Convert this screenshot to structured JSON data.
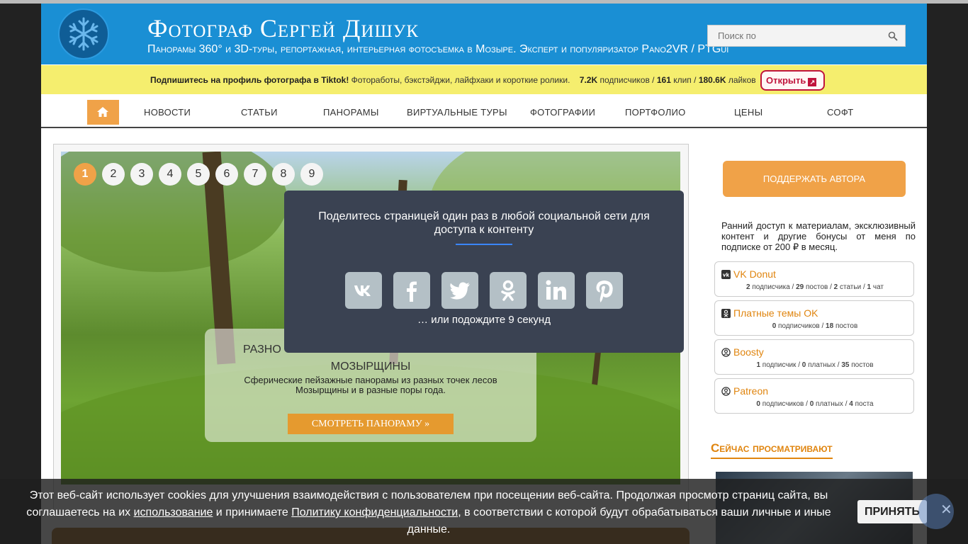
{
  "header": {
    "title": "Фотограф Сергей Дишук",
    "subtitle": "Панорамы 360° и 3D-туры, репортажная, интерьерная фотосъемка в Мозыре. Эксперт и популяризатор Pano2VR / PTGui",
    "search_placeholder": "Поиск по",
    "brand_color": "#1a8fd4"
  },
  "tiktok": {
    "lead": "Подпишитесь на профиль фотографа в Tiktok!",
    "text": " Фоторaботы, бэкстэйджи, лайфхаки и короткие ролики.",
    "subs_num": "7.2K",
    "subs_label": " подписчиков / ",
    "clips_num": "161",
    "clips_label": " клип / ",
    "likes_num": "180.6K",
    "likes_label": " лайков",
    "open_label": "Открыть"
  },
  "nav": {
    "items": [
      "НОВОСТИ",
      "СТАТЬИ",
      "ПАНОРАМЫ",
      "ВИРТУАЛЬНЫЕ ТУРЫ",
      "ФОТОГРАФИИ",
      "ПОРТФОЛИО",
      "ЦЕНЫ",
      "СОФТ"
    ]
  },
  "slider": {
    "pages": [
      "1",
      "2",
      "3",
      "4",
      "5",
      "6",
      "7",
      "8",
      "9"
    ],
    "active_page": "1",
    "caption_title_1": "РАЗНО",
    "caption_title_2": "МОЗЫРЩИНЫ",
    "caption_desc": "Сферические пейзажные панорамы из разных точек лесов Мозырщины и в разные поры года.",
    "caption_button": "СМОТРЕТЬ ПАНОРАМУ »"
  },
  "sidebar": {
    "support_button": "ПОДДЕРЖАТЬ АВТОРА",
    "support_text": "Ранний доступ к материалам, эксклюзивный контент и другие бонусы от меня по подписке от 200 ₽ в месяц.",
    "platforms": [
      {
        "name": "VK Donut",
        "icon": "vk-icon",
        "stats": [
          [
            "2",
            " подписчика / "
          ],
          [
            "29",
            " постов / "
          ],
          [
            "2",
            " статьи / "
          ],
          [
            "1",
            " чат"
          ]
        ]
      },
      {
        "name": "Платные темы OK",
        "icon": "ok-icon",
        "stats": [
          [
            "0",
            " подписчиков / "
          ],
          [
            "18",
            " постов"
          ]
        ]
      },
      {
        "name": "Boosty",
        "icon": "user-circle-icon",
        "stats": [
          [
            "1",
            " подписчик / "
          ],
          [
            "0",
            " платных / "
          ],
          [
            "35",
            " постов"
          ]
        ]
      },
      {
        "name": "Patreon",
        "icon": "user-circle-icon",
        "stats": [
          [
            "0",
            " подписчиков / "
          ],
          [
            "0",
            " платных / "
          ],
          [
            "4",
            " поста"
          ]
        ]
      }
    ],
    "now_viewing_title": "Сейчас просматривают"
  },
  "modal": {
    "title": "Поделитесь страницей один раз в любой социальной сети для доступа к контенту",
    "networks": [
      "vk-icon",
      "facebook-icon",
      "twitter-icon",
      "odnoklassniki-icon",
      "linkedin-icon",
      "pinterest-icon"
    ],
    "wait_text": "… или подождите 9 секунд"
  },
  "cookie": {
    "text_1": "Этот веб-сайт использует cookies для улучшения взаимодействия с пользователем при посещении веб-сайта. Продолжая просмотр страниц сайта, вы соглашаетесь на их ",
    "link_usage": "использование",
    "text_2": " и принимаете ",
    "link_privacy": "Политику конфиденциальности",
    "text_3": ", в соответствии с которой будут обрабатываться ваши личные и иные данные.",
    "accept": "ПРИНЯТЬ",
    "close": "✕"
  }
}
